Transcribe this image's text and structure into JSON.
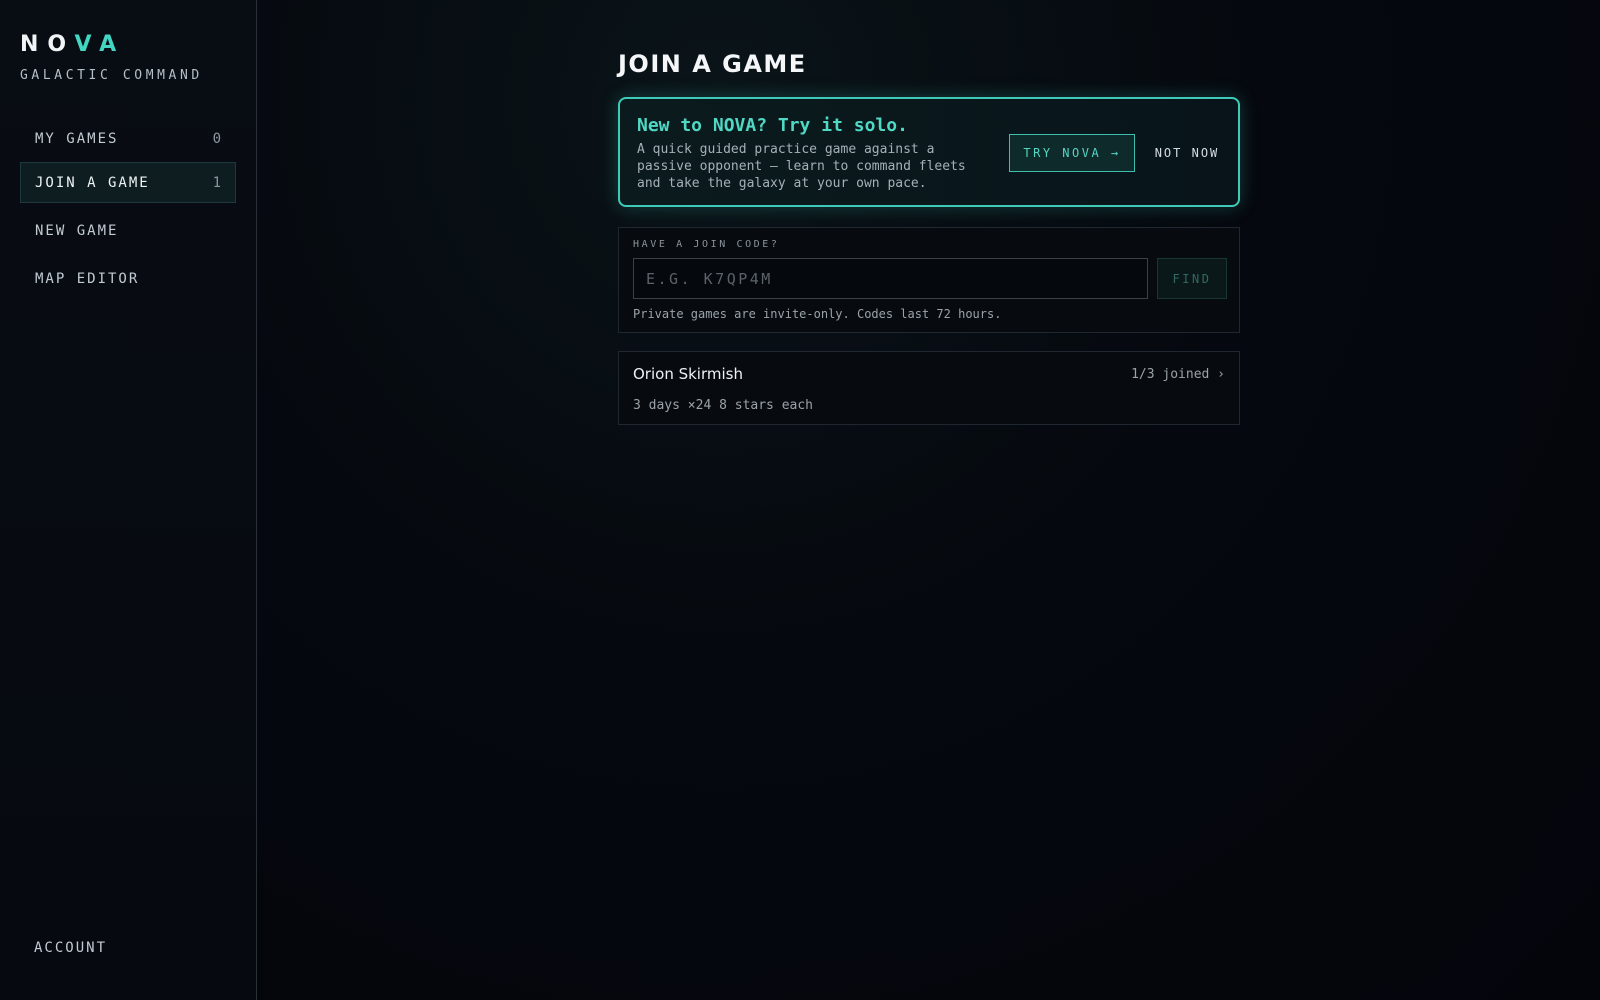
{
  "brand": {
    "part1": "NO",
    "part2": "VA",
    "subtitle": "GALACTIC COMMAND"
  },
  "colors": {
    "accent": "#43d6c2",
    "background": "#04060c"
  },
  "sidebar": {
    "items": [
      {
        "label": "MY GAMES",
        "count": "0"
      },
      {
        "label": "JOIN A GAME",
        "count": "1"
      },
      {
        "label": "NEW GAME",
        "count": ""
      },
      {
        "label": "MAP EDITOR",
        "count": ""
      }
    ],
    "account": "ACCOUNT"
  },
  "main": {
    "title": "JOIN A GAME",
    "promo": {
      "title": "New to NOVA? Try it solo.",
      "text": "A quick guided practice game against a passive opponent — learn to command fleets and take the galaxy at your own pace.",
      "try_label": "TRY NOVA →",
      "dismiss_label": "NOT NOW"
    },
    "join_code": {
      "label": "HAVE A JOIN CODE?",
      "placeholder": "E.G. K7QP4M",
      "value": "",
      "find_label": "FIND",
      "help": "Private games are invite-only. Codes last 72 hours."
    },
    "games": [
      {
        "name": "Orion Skirmish",
        "joined": "1/3 joined ›",
        "meta": "3 days ×24 8 stars each"
      }
    ]
  }
}
